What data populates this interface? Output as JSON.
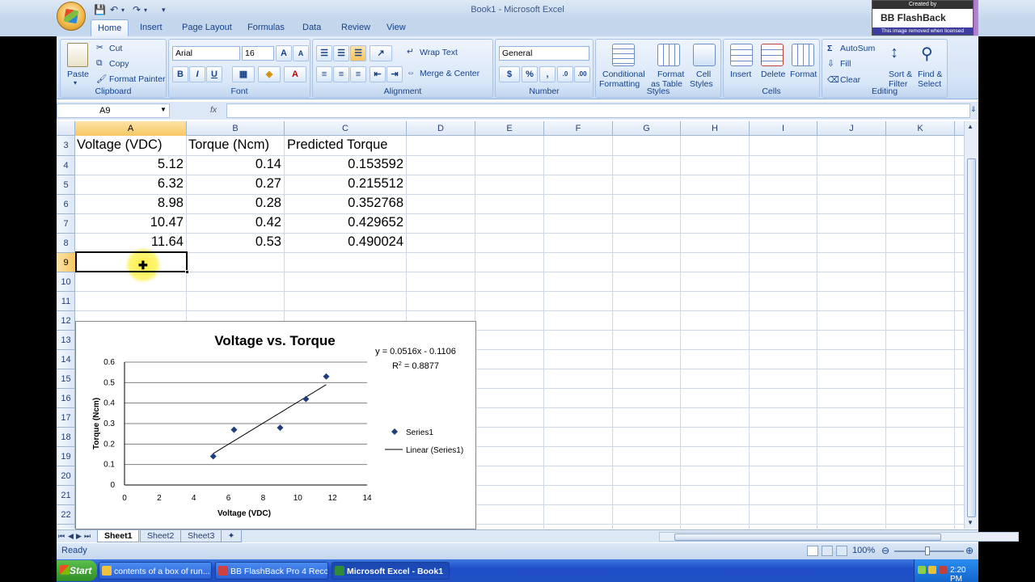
{
  "window": {
    "title": "Book1 - Microsoft Excel"
  },
  "watermark": {
    "line1": "Created by",
    "brand": "BB FlashBack",
    "line3": "This image removed when licensed"
  },
  "tabs": [
    "Home",
    "Insert",
    "Page Layout",
    "Formulas",
    "Data",
    "Review",
    "View"
  ],
  "ribbon": {
    "clipboard": {
      "label": "Clipboard",
      "paste": "Paste",
      "cut": "Cut",
      "copy": "Copy",
      "format_painter": "Format Painter"
    },
    "font": {
      "label": "Font",
      "font_name": "Arial",
      "font_size": "16",
      "bold": "B",
      "italic": "I",
      "underline": "U"
    },
    "alignment": {
      "label": "Alignment",
      "wrap_text": "Wrap Text",
      "merge_center": "Merge & Center"
    },
    "number": {
      "label": "Number",
      "format": "General",
      "currency": "$",
      "percent": "%",
      "comma": ","
    },
    "styles": {
      "label": "Styles",
      "conditional": "Conditional",
      "conditional2": "Formatting",
      "format_table": "Format",
      "format_table2": "as Table",
      "cell_styles": "Cell",
      "cell_styles2": "Styles"
    },
    "cells": {
      "label": "Cells",
      "insert": "Insert",
      "delete": "Delete",
      "format": "Format"
    },
    "editing": {
      "label": "Editing",
      "autosum": "AutoSum",
      "fill": "Fill",
      "clear": "Clear",
      "sort": "Sort &",
      "sort2": "Filter",
      "find": "Find &",
      "find2": "Select"
    }
  },
  "formula_bar": {
    "name_box": "A9",
    "fx": "fx",
    "value": ""
  },
  "columns": [
    "A",
    "B",
    "C",
    "D",
    "E",
    "F",
    "G",
    "H",
    "I",
    "J",
    "K"
  ],
  "rows": [
    "3",
    "4",
    "5",
    "6",
    "7",
    "8",
    "9",
    "10",
    "11",
    "12",
    "13",
    "14",
    "15",
    "16",
    "17",
    "18",
    "19",
    "20",
    "21",
    "22"
  ],
  "table": {
    "headers": [
      "Voltage (VDC)",
      "Torque (Ncm)",
      "Predicted Torque"
    ],
    "rows": [
      [
        "5.12",
        "0.14",
        "0.153592"
      ],
      [
        "6.32",
        "0.27",
        "0.215512"
      ],
      [
        "8.98",
        "0.28",
        "0.352768"
      ],
      [
        "10.47",
        "0.42",
        "0.429652"
      ],
      [
        "11.64",
        "0.53",
        "0.490024"
      ]
    ]
  },
  "chart_data": {
    "type": "scatter",
    "title": "Voltage vs. Torque",
    "xlabel": "Voltage (VDC)",
    "ylabel": "Torque (Ncm)",
    "xlim": [
      0,
      14
    ],
    "ylim": [
      0,
      0.6
    ],
    "xticks": [
      "0",
      "2",
      "4",
      "6",
      "8",
      "10",
      "12",
      "14"
    ],
    "yticks": [
      "0",
      "0.1",
      "0.2",
      "0.3",
      "0.4",
      "0.5",
      "0.6"
    ],
    "grid": "horizontal",
    "legend": "right",
    "series": [
      {
        "name": "Series1",
        "x": [
          5.12,
          6.32,
          8.98,
          10.47,
          11.64
        ],
        "y": [
          0.14,
          0.27,
          0.28,
          0.42,
          0.53
        ]
      }
    ],
    "trendline": {
      "name": "Linear (Series1)",
      "slope": 0.0516,
      "intercept": -0.1106,
      "x_range": [
        5.12,
        11.64
      ]
    },
    "equation": "y = 0.0516x - 0.1106",
    "r2_prefix": "R",
    "r2_sup": "2",
    "r2_value": " = 0.8877"
  },
  "sheets": [
    "Sheet1",
    "Sheet2",
    "Sheet3"
  ],
  "status": {
    "text": "Ready",
    "zoom": "100%"
  },
  "taskbar": {
    "start": "Start",
    "items": [
      "contents of a box of run...",
      "BB FlashBack Pro 4 Reco...",
      "Microsoft Excel - Book1"
    ],
    "clock": "2:20 PM"
  }
}
